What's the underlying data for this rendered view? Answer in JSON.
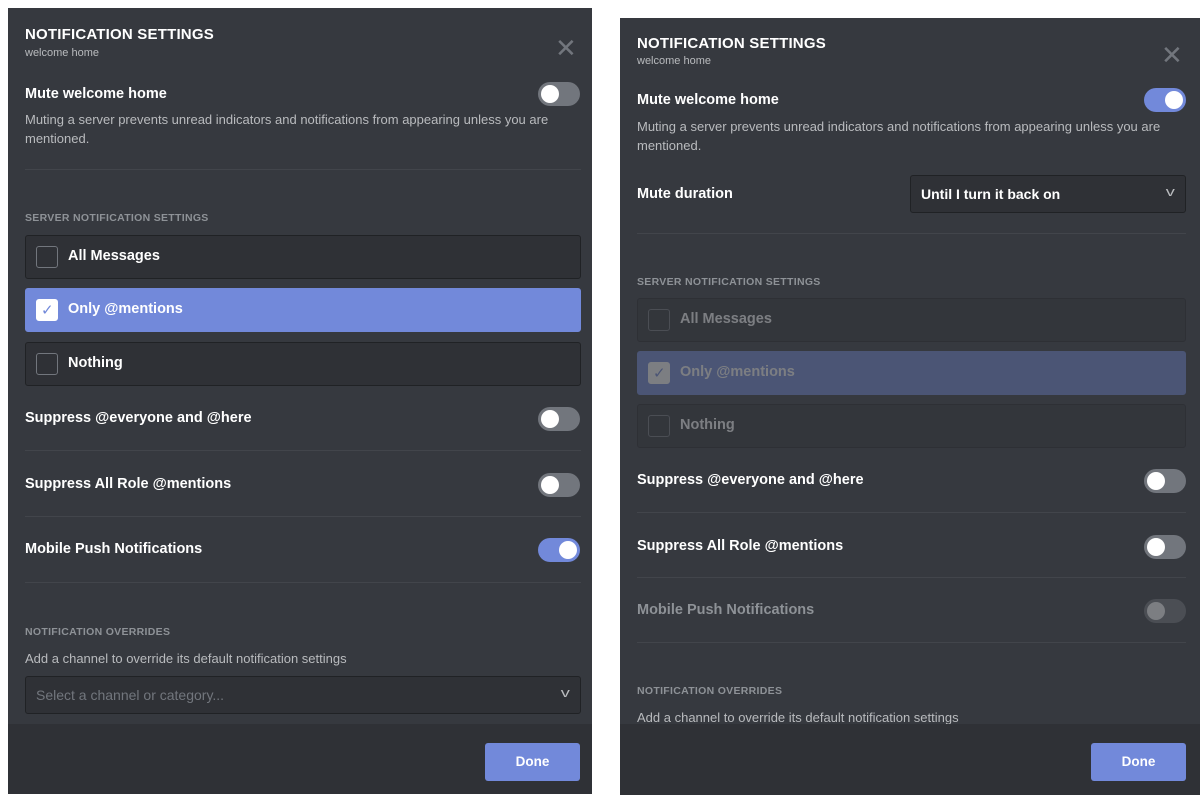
{
  "colors": {
    "accent": "#7289da",
    "background": "#36393f",
    "footer": "#2f3136"
  },
  "left": {
    "title": "NOTIFICATION SETTINGS",
    "subtitle": "welcome home",
    "mute": {
      "prefix": "Mute ",
      "name": "welcome home",
      "on": false
    },
    "mute_desc": "Muting a server prevents unread indicators and notifications from appearing unless you are mentioned.",
    "server_section": "SERVER NOTIFICATION SETTINGS",
    "options": [
      {
        "label": "All Messages",
        "selected": false
      },
      {
        "label": "Only @mentions",
        "selected": true
      },
      {
        "label": "Nothing",
        "selected": false
      }
    ],
    "suppress_everyone": {
      "p1": "Suppress ",
      "b1": "@everyone",
      "p2": " and ",
      "b2": "@here",
      "on": false
    },
    "suppress_roles": {
      "label": "Suppress All Role @mentions",
      "on": false
    },
    "mobile_push": {
      "label": "Mobile Push Notifications",
      "on": true
    },
    "overrides_section": "NOTIFICATION OVERRIDES",
    "overrides_desc": "Add a channel to override its default notification settings",
    "channel_select_placeholder": "Select a channel or category...",
    "done_label": "Done"
  },
  "right": {
    "title": "NOTIFICATION SETTINGS",
    "subtitle": "welcome home",
    "mute": {
      "prefix": "Mute ",
      "name": "welcome home",
      "on": true
    },
    "mute_desc": "Muting a server prevents unread indicators and notifications from appearing unless you are mentioned.",
    "mute_duration_label": "Mute duration",
    "mute_duration_value": "Until I turn it back on",
    "server_section": "SERVER NOTIFICATION SETTINGS",
    "options": [
      {
        "label": "All Messages",
        "selected": false
      },
      {
        "label": "Only @mentions",
        "selected": true
      },
      {
        "label": "Nothing",
        "selected": false
      }
    ],
    "suppress_everyone": {
      "p1": "Suppress ",
      "b1": "@everyone",
      "p2": " and ",
      "b2": "@here",
      "on": false
    },
    "suppress_roles": {
      "label": "Suppress All Role @mentions",
      "on": false
    },
    "mobile_push": {
      "label": "Mobile Push Notifications",
      "on": false,
      "disabled": true
    },
    "overrides_section": "NOTIFICATION OVERRIDES",
    "overrides_desc": "Add a channel to override its default notification settings",
    "done_label": "Done"
  }
}
